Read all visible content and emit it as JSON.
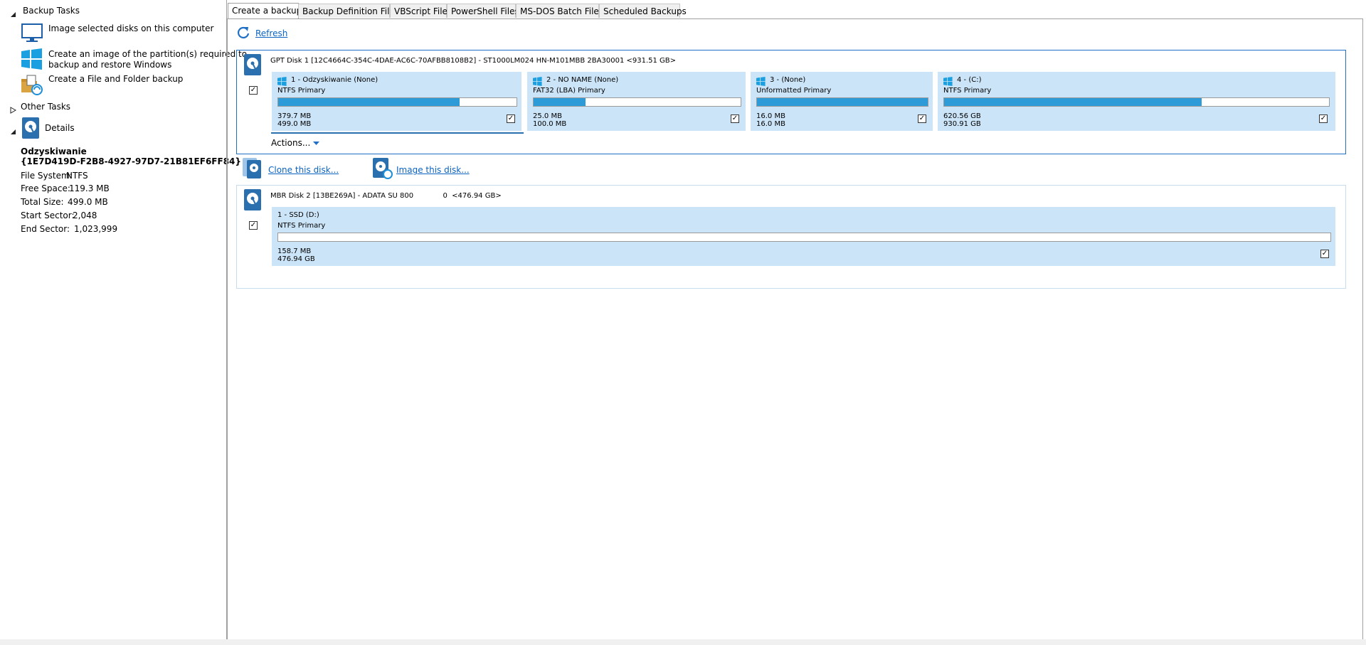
{
  "sidebar": {
    "backup_tasks_header": "Backup Tasks",
    "tasks": [
      {
        "label": "Image selected disks on this computer",
        "icon": "monitor-icon"
      },
      {
        "label_line1": "Create an image of the partition(s) required to",
        "label_line2": "backup and restore Windows",
        "icon": "windows-logo-icon"
      },
      {
        "label": "Create a File and Folder backup",
        "icon": "folder-backup-icon"
      }
    ],
    "other_tasks_header": "Other Tasks",
    "details_header": "Details",
    "details": {
      "name": "Odzyskiwanie",
      "guid": "{1E7D419D-F2B8-4927-97D7-21B81EF6FF84}",
      "file_system_label": "File System:",
      "file_system_value": "NTFS",
      "free_space_label": "Free Space:",
      "free_space_value": "119.3 MB",
      "total_size_label": "Total Size:",
      "total_size_value": "499.0 MB",
      "start_sector_label": "Start Sector:",
      "start_sector_value": "2,048",
      "end_sector_label": "End Sector:",
      "end_sector_value": "1,023,999"
    }
  },
  "tabs": [
    "Create a backup",
    "Backup Definition Files",
    "VBScript Files",
    "PowerShell Files",
    "MS-DOS Batch Files",
    "Scheduled Backups"
  ],
  "toolbar": {
    "refresh_label": "Refresh"
  },
  "disk1": {
    "title": "GPT Disk 1 [12C4664C-354C-4DAE-AC6C-70AFBB8108B2] - ST1000LM024 HN-M101MBB 2BA30001  <931.51 GB>",
    "checked": true,
    "partitions": [
      {
        "name": "1 - Odzyskiwanie (None)",
        "type": "NTFS Primary",
        "used": "379.7 MB",
        "total": "499.0 MB",
        "fill_fraction": 0.76,
        "checked": true
      },
      {
        "name": "2 - NO NAME (None)",
        "type": "FAT32 (LBA) Primary",
        "used": "25.0 MB",
        "total": "100.0 MB",
        "fill_fraction": 0.25,
        "checked": true
      },
      {
        "name": "3 -  (None)",
        "type": "Unformatted Primary",
        "used": "16.0 MB",
        "total": "16.0 MB",
        "fill_fraction": 1.0,
        "checked": true
      },
      {
        "name": "4 -  (C:)",
        "type": "NTFS Primary",
        "used": "620.56 GB",
        "total": "930.91 GB",
        "fill_fraction": 0.67,
        "checked": true
      }
    ],
    "actions_label": "Actions...",
    "clone_label": "Clone this disk...",
    "image_label": "Image this disk..."
  },
  "disk2": {
    "title": "MBR Disk 2 [13BE269A] - ADATA SU 800             0  <476.94 GB>",
    "checked": true,
    "partitions": [
      {
        "name": "1 - SSD (D:)",
        "type": "NTFS Primary",
        "used": "158.7 MB",
        "total": "476.94 GB",
        "fill_fraction": 0.0,
        "checked": true
      }
    ]
  },
  "colors": {
    "accent": "#2d9bd8",
    "partition_bg": "#cce4f7",
    "selected_border": "#1f6fc5",
    "link": "#0b63c1"
  }
}
